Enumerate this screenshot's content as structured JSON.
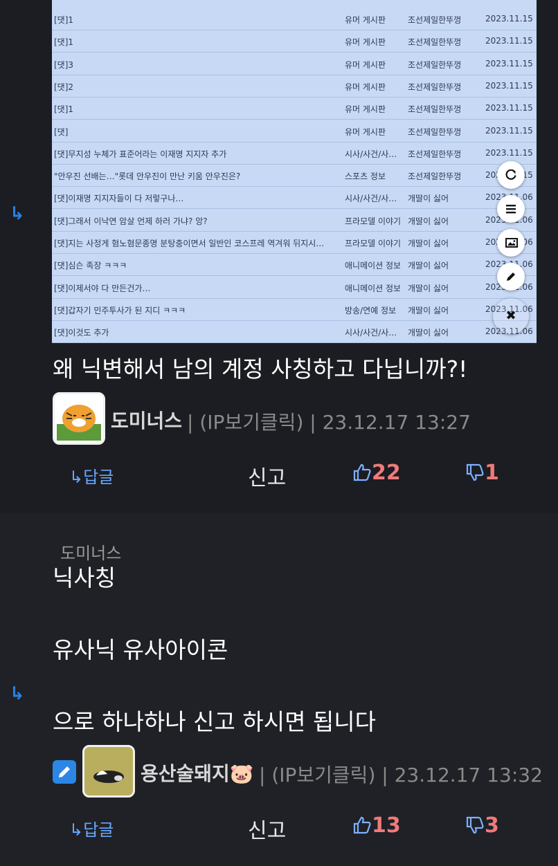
{
  "embedded_list": {
    "rows": [
      {
        "title": "[댓]1",
        "board": "유머 게시판",
        "author": "조선제일한뚜껑",
        "date": "2023.11.15"
      },
      {
        "title": "[댓]1",
        "board": "유머 게시판",
        "author": "조선제일한뚜껑",
        "date": "2023.11.15"
      },
      {
        "title": "[댓]3",
        "board": "유머 게시판",
        "author": "조선제일한뚜껑",
        "date": "2023.11.15"
      },
      {
        "title": "[댓]2",
        "board": "유머 게시판",
        "author": "조선제일한뚜껑",
        "date": "2023.11.15"
      },
      {
        "title": "[댓]1",
        "board": "유머 게시판",
        "author": "조선제일한뚜껑",
        "date": "2023.11.15"
      },
      {
        "title": "[댓]",
        "board": "유머 게시판",
        "author": "조선제일한뚜껑",
        "date": "2023.11.15"
      },
      {
        "title": "[댓]무지성 누체가 표준어라는 이재명 지지자 추가",
        "board": "시사/사건/사…",
        "author": "조선제일한뚜껑",
        "date": "2023.11.15"
      },
      {
        "title": "\"안우진 선배는…\"롯데 안우진이 만난 키움 안우진은?",
        "board": "스포츠 정보",
        "author": "조선제일한뚜껑",
        "date": "2023.11.15"
      },
      {
        "title": "[댓]이재명 지지자들이 다 저렇구나…",
        "board": "시사/사건/사…",
        "author": "개딸이 싫어",
        "date": "2023.11.06"
      },
      {
        "title": "[댓]그래서 이낙연 암살 언제 하러 가냐? 앙?",
        "board": "프라모델 이야기",
        "author": "개딸이 싫어",
        "date": "2023.11.06"
      },
      {
        "title": "[댓]지는 사정게 혐노혐문종명 분탕충이면서 일반인 코스프레 역겨워 뒤지시…",
        "board": "프라모델 이야기",
        "author": "개딸이 싫어",
        "date": "2023.11.06"
      },
      {
        "title": "[댓]심슨 족장 ㅋㅋㅋ",
        "board": "애니메이션 정보",
        "author": "개딸이 싫어",
        "date": "2023.11.06"
      },
      {
        "title": "[댓]이제서야 다 만든건가…",
        "board": "애니메이션 정보",
        "author": "개딸이 싫어",
        "date": "2023.11.06"
      },
      {
        "title": "[댓]갑자기 민주투사가 된 지디 ㅋㅋㅋ",
        "board": "방송/연예 정보",
        "author": "개딸이 싫어",
        "date": "2023.11.06"
      },
      {
        "title": "[댓]이것도 추가",
        "board": "시사/사건/사…",
        "author": "개딸이 싫어",
        "date": "2023.11.06"
      }
    ]
  },
  "fab": {
    "refresh_icon": "refresh-icon",
    "menu_icon": "menu-icon",
    "image_icon": "image-icon",
    "pencil_icon": "pencil-icon",
    "close_label": "✖"
  },
  "comments": [
    {
      "text": "왜 닉변해서 남의 계정 사칭하고 다닙니까?!",
      "nick": "도미너스",
      "meta": "| (IP보기클릭) | 23.12.17 13:27",
      "reply_label": "↳답글",
      "report_label": "신고",
      "up_count": "22",
      "down_count": "1"
    },
    {
      "parent_nick": "도미너스",
      "lines": [
        "닉사칭",
        "유사닉 유사아이콘",
        "으로 하나하나 신고 하시면 됩니다"
      ],
      "nick": "용산술돼지🐷",
      "meta": "| (IP보기클릭) | 23.12.17 13:32",
      "reply_label": "↳답글",
      "report_label": "신고",
      "up_count": "13",
      "down_count": "3"
    }
  ],
  "colors": {
    "accent": "#2a7fe0",
    "like": "#7fb0ff",
    "count": "#f07a7a"
  }
}
